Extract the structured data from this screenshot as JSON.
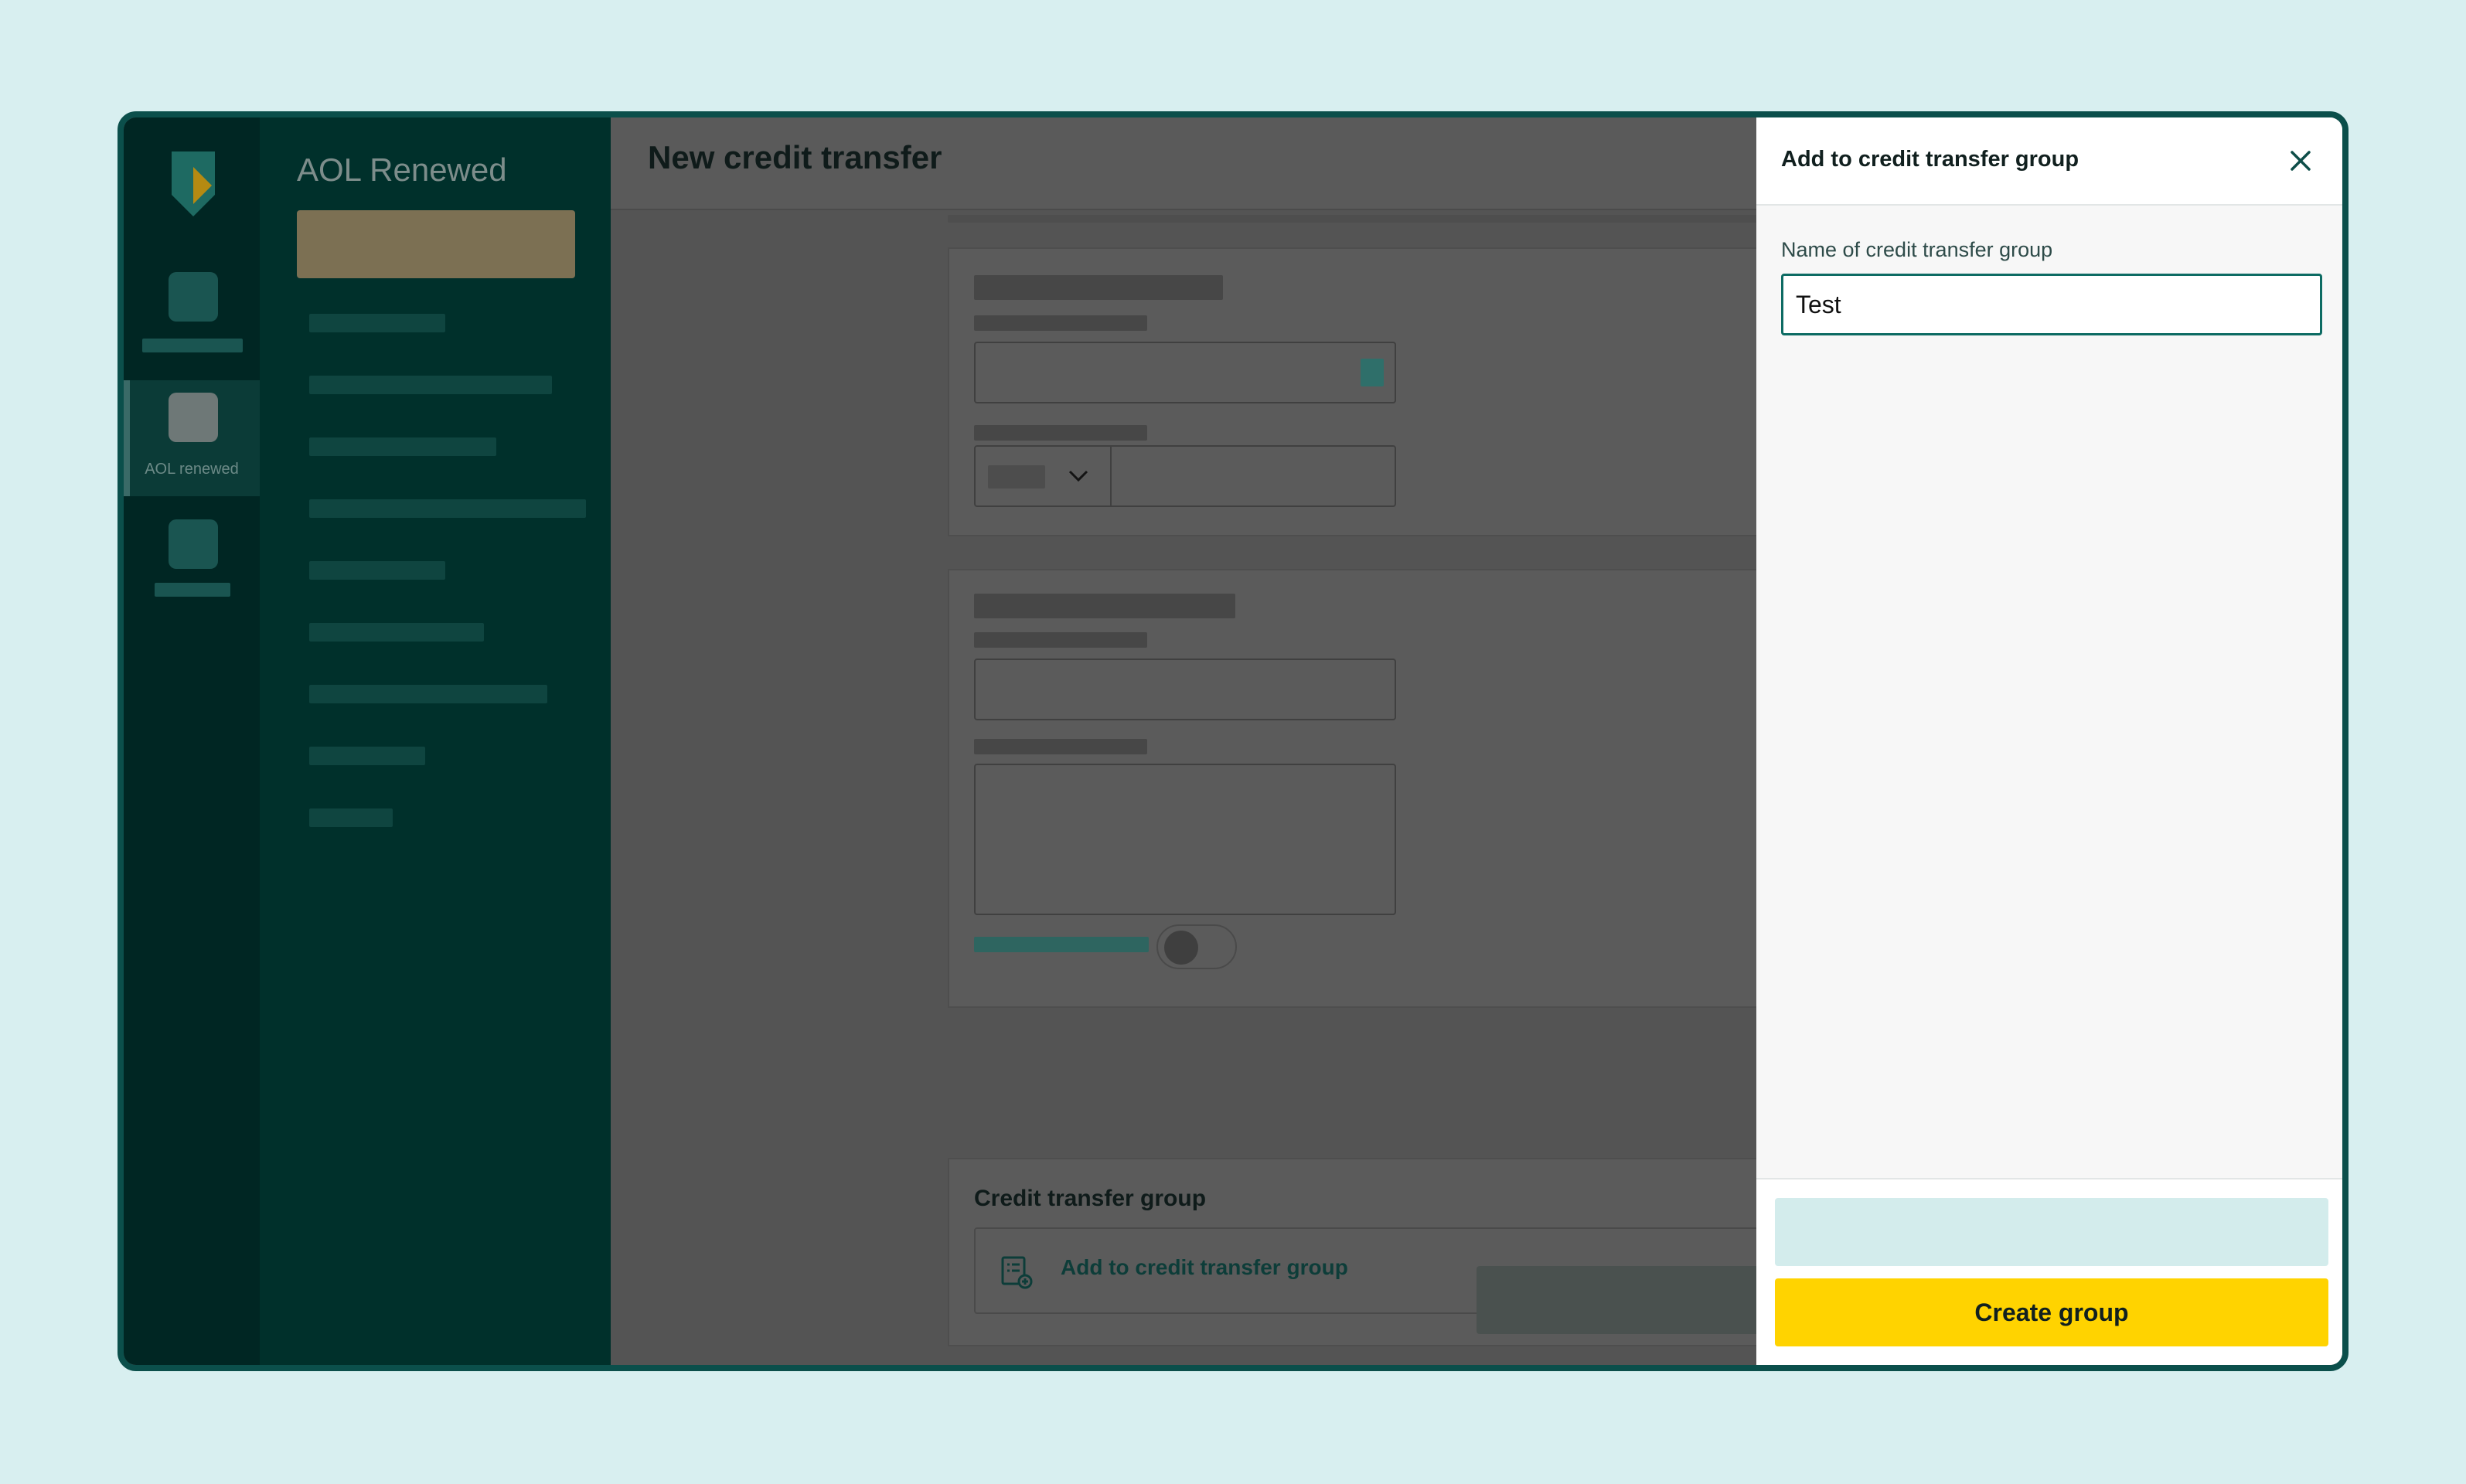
{
  "app": {
    "rail": {
      "active_label": "AOL renewed"
    },
    "menu": {
      "title": "AOL Renewed"
    }
  },
  "main": {
    "title": "New credit transfer",
    "group_section": {
      "label": "Credit transfer group",
      "add_action": "Add to credit transfer group"
    }
  },
  "drawer": {
    "title": "Add to credit transfer group",
    "field_label": "Name of credit transfer group",
    "field_value": "Test",
    "create_label": "Create group"
  },
  "colors": {
    "accent": "#0d6b63",
    "primary_button": "#ffd300",
    "frame_border": "#0b4f4b"
  },
  "icons": [
    "brand-logo-icon",
    "chevron-down-icon",
    "group-list-icon",
    "close-icon"
  ]
}
